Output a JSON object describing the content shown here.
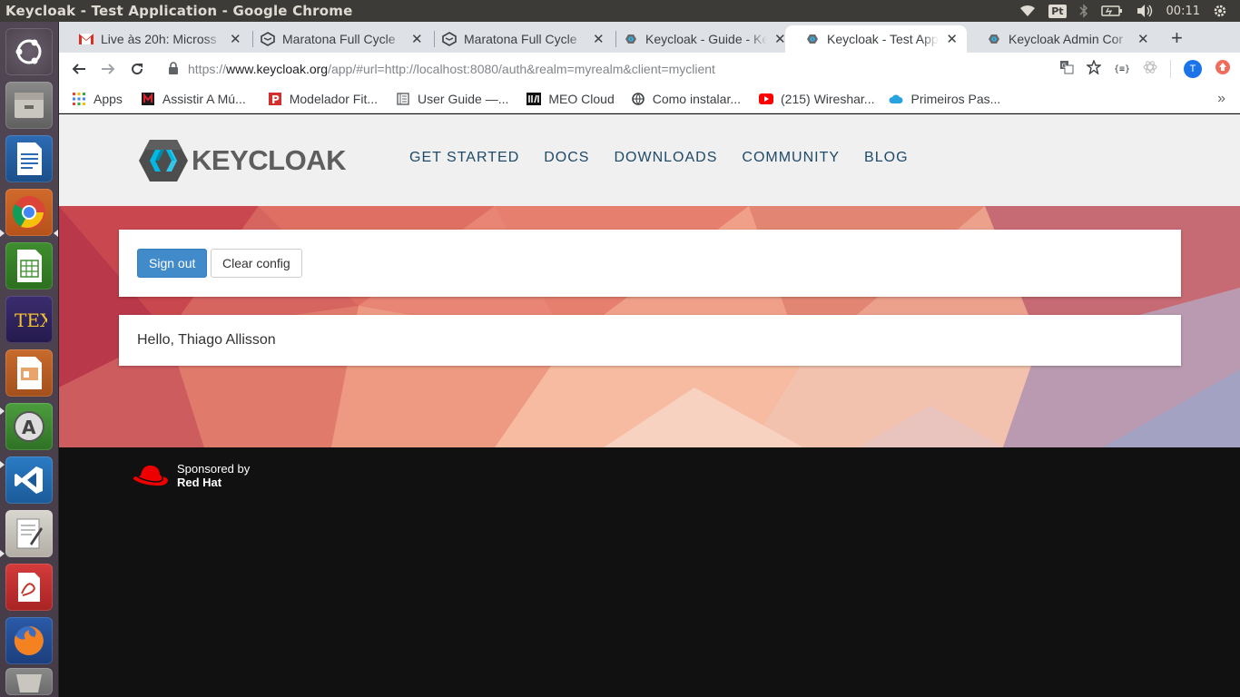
{
  "window": {
    "title": "Keycloak - Test Application - Google Chrome"
  },
  "top_panel": {
    "language": "Pt",
    "clock": "00:11"
  },
  "launcher": {
    "items": [
      "ubuntu-dash",
      "files",
      "libreoffice-writer",
      "chrome",
      "libreoffice-calc",
      "texmaker",
      "libreoffice-impress",
      "software-updater",
      "vscode",
      "text-editor",
      "document-viewer",
      "firefox",
      "trash"
    ]
  },
  "tabs": [
    {
      "title": "Live às 20h: Micross",
      "icon": "gmail-icon"
    },
    {
      "title": "Maratona Full Cycle",
      "icon": "maratona-icon"
    },
    {
      "title": "Maratona Full Cycle",
      "icon": "maratona-icon"
    },
    {
      "title": "Keycloak - Guide - Ke",
      "icon": "keycloak-icon"
    },
    {
      "title": "Keycloak - Test Appl",
      "icon": "keycloak-icon"
    },
    {
      "title": "Keycloak Admin Cor",
      "icon": "keycloak-icon"
    }
  ],
  "toolbar": {
    "url_prefix": "https://",
    "url_host": "www.keycloak.org",
    "url_rest": "/app/#url=http://localhost:8080/auth&realm=myrealm&client=myclient",
    "profile_initial": "T"
  },
  "bookmarks": [
    {
      "label": "Apps",
      "icon": "apps-grid-icon"
    },
    {
      "label": "Assistir A Mú...",
      "icon": "music-icon"
    },
    {
      "label": "Modelador Fit...",
      "icon": "p-icon"
    },
    {
      "label": "User Guide —...",
      "icon": "book-icon"
    },
    {
      "label": "MEO Cloud",
      "icon": "meo-icon"
    },
    {
      "label": "Como instalar...",
      "icon": "globe-icon"
    },
    {
      "label": "(215) Wireshar...",
      "icon": "youtube-icon"
    },
    {
      "label": "Primeiros Pas...",
      "icon": "cloud-icon"
    }
  ],
  "site": {
    "logo": "KEYCLOAK",
    "nav": [
      "GET STARTED",
      "DOCS",
      "DOWNLOADS",
      "COMMUNITY",
      "BLOG"
    ],
    "sign_out": "Sign out",
    "clear_config": "Clear config",
    "greeting": "Hello, Thiago Allisson",
    "sponsored_by": "Sponsored by",
    "sponsor_name": "Red Hat"
  },
  "colors": {
    "primary_button": "#428bca",
    "nav_text": "#1f4a68",
    "panel": "#3c3b37"
  }
}
